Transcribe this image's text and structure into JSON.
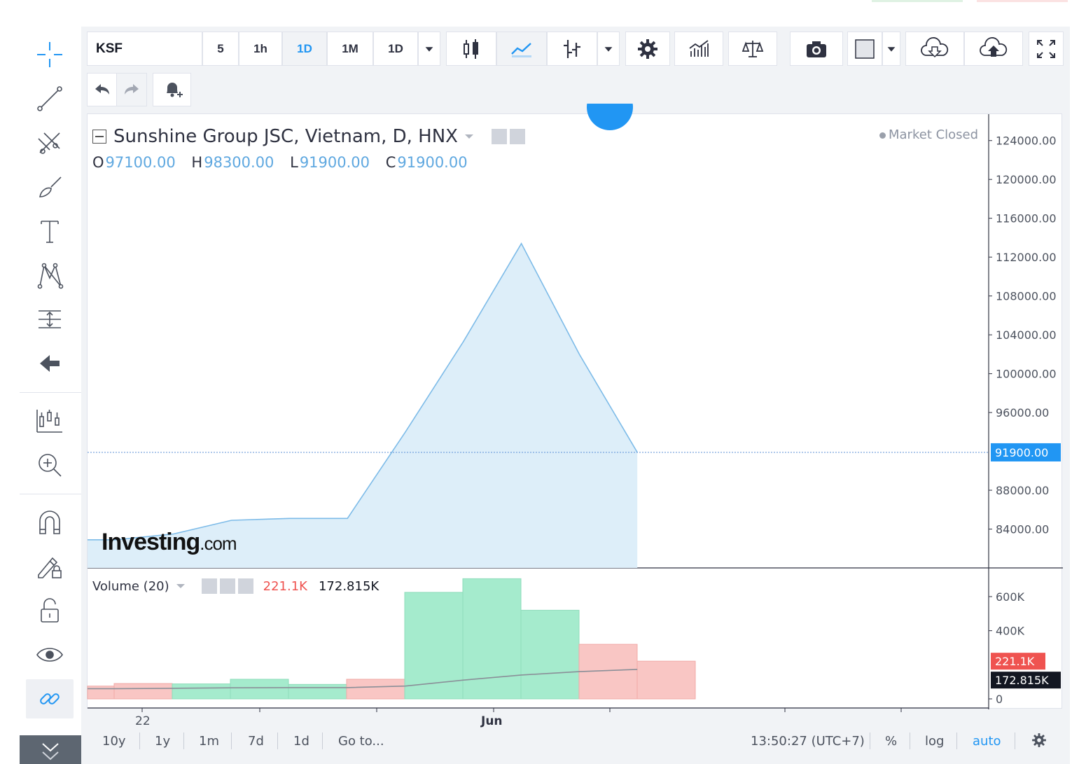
{
  "toolbar": {
    "symbol": "KSF",
    "intervals": [
      "5",
      "1h",
      "1D",
      "1M",
      "1D"
    ],
    "active_interval_index": 2
  },
  "legend": {
    "title": "Sunshine Group JSC, Vietnam, D, HNX",
    "ohlc": {
      "o_label": "O",
      "o_value": "97100.00",
      "h_label": "H",
      "h_value": "98300.00",
      "l_label": "L",
      "l_value": "91900.00",
      "c_label": "C",
      "c_value": "91900.00"
    },
    "market_status": "Market Closed"
  },
  "watermark": {
    "brand": "Investing",
    "suffix": ".com"
  },
  "volume_legend": {
    "label": "Volume (20)",
    "value1": "221.1K",
    "value2": "172.815K"
  },
  "chart_data": {
    "type": "area",
    "price_axis_ticks": [
      "124000.00",
      "120000.00",
      "116000.00",
      "112000.00",
      "108000.00",
      "104000.00",
      "100000.00",
      "96000.00",
      "88000.00",
      "84000.00"
    ],
    "last_price_label": "91900.00",
    "x_labels": [
      "22",
      "Jun"
    ],
    "price_series": [
      82900,
      82900,
      83500,
      84900,
      85100,
      85100,
      94000,
      103300,
      113400,
      102000,
      91900
    ],
    "ylim": [
      80000,
      126000
    ],
    "volume_axis_ticks": [
      "600K",
      "400K",
      "0"
    ],
    "volume_labels": {
      "current": "221.1K",
      "ma": "172.815K"
    },
    "volume_bars": [
      {
        "value": 75000,
        "dir": "down"
      },
      {
        "value": 90000,
        "dir": "down"
      },
      {
        "value": 88000,
        "dir": "up"
      },
      {
        "value": 115000,
        "dir": "up"
      },
      {
        "value": 85000,
        "dir": "up"
      },
      {
        "value": 115000,
        "dir": "down"
      },
      {
        "value": 625000,
        "dir": "up"
      },
      {
        "value": 705000,
        "dir": "up"
      },
      {
        "value": 520000,
        "dir": "up"
      },
      {
        "value": 320000,
        "dir": "down"
      },
      {
        "value": 221100,
        "dir": "down"
      }
    ],
    "volume_ma": [
      60000,
      60000,
      62000,
      65000,
      66000,
      66000,
      75000,
      110000,
      140000,
      160000,
      172815
    ],
    "vol_ylim": [
      0,
      760000
    ]
  },
  "bottom_bar": {
    "ranges": [
      "10y",
      "1y",
      "1m",
      "7d",
      "1d"
    ],
    "goto": "Go to...",
    "clock": "13:50:27 (UTC+7)",
    "percent": "%",
    "log": "log",
    "auto": "auto"
  },
  "colors": {
    "accent": "#2196f3",
    "area_fill": "#ddeef9",
    "area_line": "#7dbbe8",
    "vol_up": "#a5ebcd",
    "vol_down": "#f9c6c4",
    "price_label_bg": "#2196f3",
    "vol_label_red": "#ef5350",
    "vol_label_black": "#131722"
  }
}
